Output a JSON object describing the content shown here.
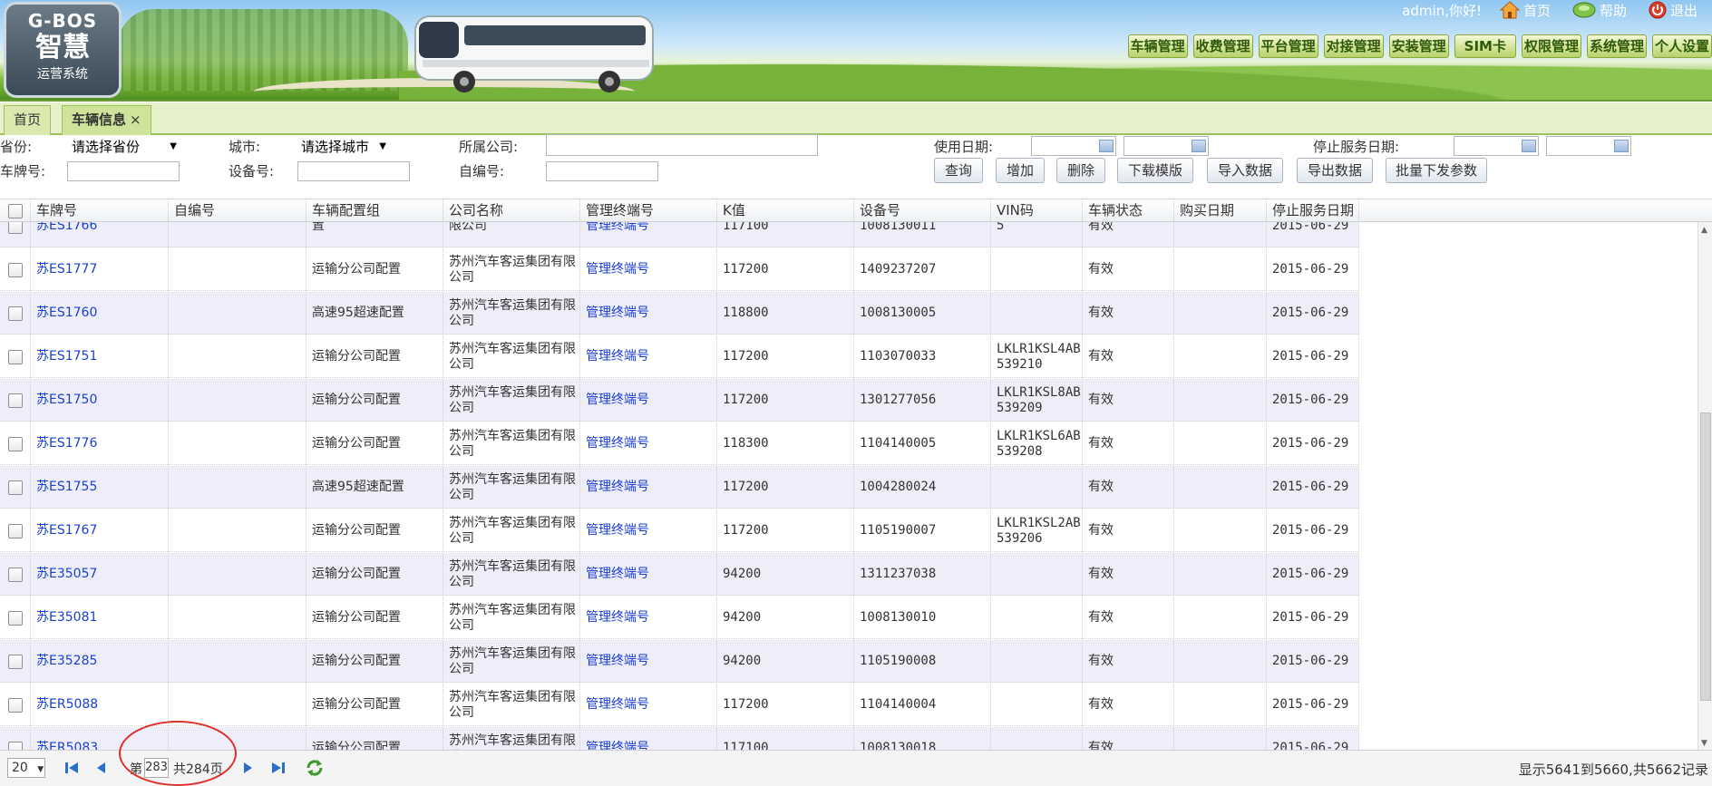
{
  "app": {
    "logo": {
      "brand": "G-BOS",
      "title": "智慧",
      "subtitle": "运营系统"
    },
    "user_greeting": "admin,你好!",
    "top_links": [
      {
        "label": "首页",
        "icon": "home-icon"
      },
      {
        "label": "帮助",
        "icon": "help-icon"
      },
      {
        "label": "退出",
        "icon": "power-icon"
      }
    ],
    "menu": [
      "车辆管理",
      "收费管理",
      "平台管理",
      "对接管理",
      "安装管理",
      "SIM卡",
      "权限管理",
      "系统管理",
      "个人设置"
    ]
  },
  "tabs": [
    {
      "label": "首页"
    },
    {
      "label": "车辆信息",
      "close": "×"
    }
  ],
  "filters": {
    "province_label": "省份:",
    "province_value": "请选择省份",
    "city_label": "城市:",
    "city_value": "请选择城市",
    "company_label": "所属公司:",
    "company_value": "",
    "use_date_label": "使用日期:",
    "stop_date_label": "停止服务日期:",
    "plate_label": "车牌号:",
    "plate_value": "",
    "device_label": "设备号:",
    "device_value": "",
    "selfno_label": "自编号:",
    "selfno_value": "",
    "buttons": [
      "查询",
      "增加",
      "删除",
      "下载模版",
      "导入数据",
      "导出数据",
      "批量下发参数"
    ]
  },
  "table": {
    "columns": [
      "车牌号",
      "自编号",
      "车辆配置组",
      "公司名称",
      "管理终端号",
      "K值",
      "设备号",
      "VIN码",
      "车辆状态",
      "购买日期",
      "停止服务日期"
    ],
    "partial_row": [
      "苏ES1766",
      "",
      "置",
      "限公司",
      "管理终端号",
      "117100",
      "1008130011",
      "5",
      "有效",
      "",
      "2015-06-29"
    ],
    "rows": [
      [
        "苏ES1777",
        "",
        "运输分公司配置",
        "苏州汽车客运集团有限公司",
        "管理终端号",
        "117200",
        "1409237207",
        "",
        "有效",
        "",
        "2015-06-29"
      ],
      [
        "苏ES1760",
        "",
        "高速95超速配置",
        "苏州汽车客运集团有限公司",
        "管理终端号",
        "118800",
        "1008130005",
        "",
        "有效",
        "",
        "2015-06-29"
      ],
      [
        "苏ES1751",
        "",
        "运输分公司配置",
        "苏州汽车客运集团有限公司",
        "管理终端号",
        "117200",
        "1103070033",
        "LKLR1KSL4AB539210",
        "有效",
        "",
        "2015-06-29"
      ],
      [
        "苏ES1750",
        "",
        "运输分公司配置",
        "苏州汽车客运集团有限公司",
        "管理终端号",
        "117200",
        "1301277056",
        "LKLR1KSL8AB539209",
        "有效",
        "",
        "2015-06-29"
      ],
      [
        "苏ES1776",
        "",
        "运输分公司配置",
        "苏州汽车客运集团有限公司",
        "管理终端号",
        "118300",
        "1104140005",
        "LKLR1KSL6AB539208",
        "有效",
        "",
        "2015-06-29"
      ],
      [
        "苏ES1755",
        "",
        "高速95超速配置",
        "苏州汽车客运集团有限公司",
        "管理终端号",
        "117200",
        "1004280024",
        "",
        "有效",
        "",
        "2015-06-29"
      ],
      [
        "苏ES1767",
        "",
        "运输分公司配置",
        "苏州汽车客运集团有限公司",
        "管理终端号",
        "117200",
        "1105190007",
        "LKLR1KSL2AB539206",
        "有效",
        "",
        "2015-06-29"
      ],
      [
        "苏E35057",
        "",
        "运输分公司配置",
        "苏州汽车客运集团有限公司",
        "管理终端号",
        "94200",
        "1311237038",
        "",
        "有效",
        "",
        "2015-06-29"
      ],
      [
        "苏E35081",
        "",
        "运输分公司配置",
        "苏州汽车客运集团有限公司",
        "管理终端号",
        "94200",
        "1008130010",
        "",
        "有效",
        "",
        "2015-06-29"
      ],
      [
        "苏E35285",
        "",
        "运输分公司配置",
        "苏州汽车客运集团有限公司",
        "管理终端号",
        "94200",
        "1105190008",
        "",
        "有效",
        "",
        "2015-06-29"
      ],
      [
        "苏ER5088",
        "",
        "运输分公司配置",
        "苏州汽车客运集团有限公司",
        "管理终端号",
        "117200",
        "1104140004",
        "",
        "有效",
        "",
        "2015-06-29"
      ],
      [
        "苏ER5083",
        "",
        "运输分公司配置",
        "苏州汽车客运集团有限公司",
        "管理终端号",
        "117100",
        "1008130018",
        "",
        "有效",
        "",
        "2015-06-29"
      ]
    ]
  },
  "pager": {
    "page_size": "20",
    "page_prefix": "第",
    "current_page": "283",
    "total_text": "共284页",
    "info": "显示5641到5660,共5662记录"
  },
  "colors": {
    "accent_green": "#9ac35b",
    "link_blue": "#1a3fd0",
    "row_alt": "#eeeefa",
    "annotation_red": "#e0302a"
  }
}
